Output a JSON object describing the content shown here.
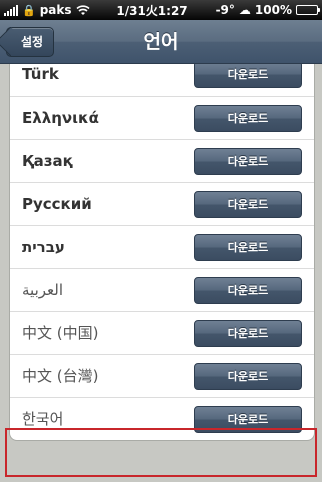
{
  "status_bar": {
    "carrier": "paks",
    "time": "1/31火1:27",
    "weather": "-9°",
    "battery": "100%"
  },
  "nav": {
    "back_label": "설정",
    "title": "언어"
  },
  "languages": [
    {
      "label": "Türk",
      "action": "다운로드"
    },
    {
      "label": "Ελληνικά",
      "action": "다운로드"
    },
    {
      "label": "Қазақ",
      "action": "다운로드"
    },
    {
      "label": "Русский",
      "action": "다운로드"
    },
    {
      "label": "עברית",
      "action": "다운로드"
    },
    {
      "label": "العربية",
      "action": "다운로드"
    },
    {
      "label": "中文 (中国)",
      "action": "다운로드"
    },
    {
      "label": "中文 (台灣)",
      "action": "다운로드"
    },
    {
      "label": "한국어",
      "action": "다운로드"
    }
  ],
  "highlight_color": "#c8262b"
}
